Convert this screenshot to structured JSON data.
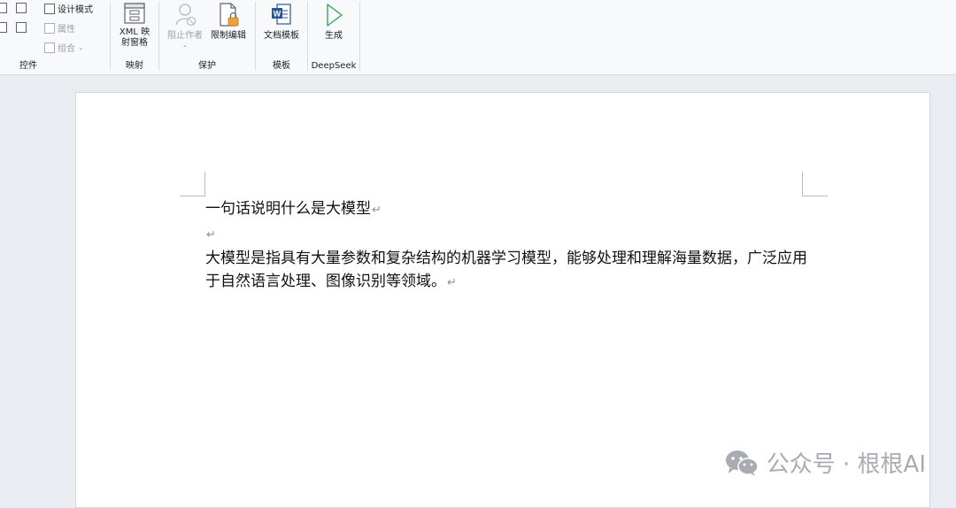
{
  "ribbon": {
    "controls_group": {
      "design_mode_label": "设计模式",
      "properties_label": "属性",
      "group_label_btn": "组合",
      "label": "控件"
    },
    "mapping_group": {
      "xml_pane_line1": "XML 映",
      "xml_pane_line2": "射窗格",
      "label": "映射"
    },
    "protect_group": {
      "block_authors_label": "阻止作者",
      "restrict_editing_label": "限制编辑",
      "label": "保护"
    },
    "template_group": {
      "doc_template_label": "文档模板",
      "label": "模板"
    },
    "deepseek_group": {
      "generate_label": "生成",
      "label": "DeepSeek"
    }
  },
  "document": {
    "title_line": "一句话说明什么是大模型",
    "paragraph_line1": "大模型是指具有大量参数和复杂结构的机器学习模型，能够处理和理解海量数据，广泛应用",
    "paragraph_line2": "于自然语言处理、图像识别等领域。",
    "paragraph_mark": "↵"
  },
  "watermark": {
    "text": "公众号 · 根根AI"
  },
  "colors": {
    "word_blue": "#2b579a",
    "generate_green": "#3aa856",
    "lock_orange": "#e8a33a"
  }
}
